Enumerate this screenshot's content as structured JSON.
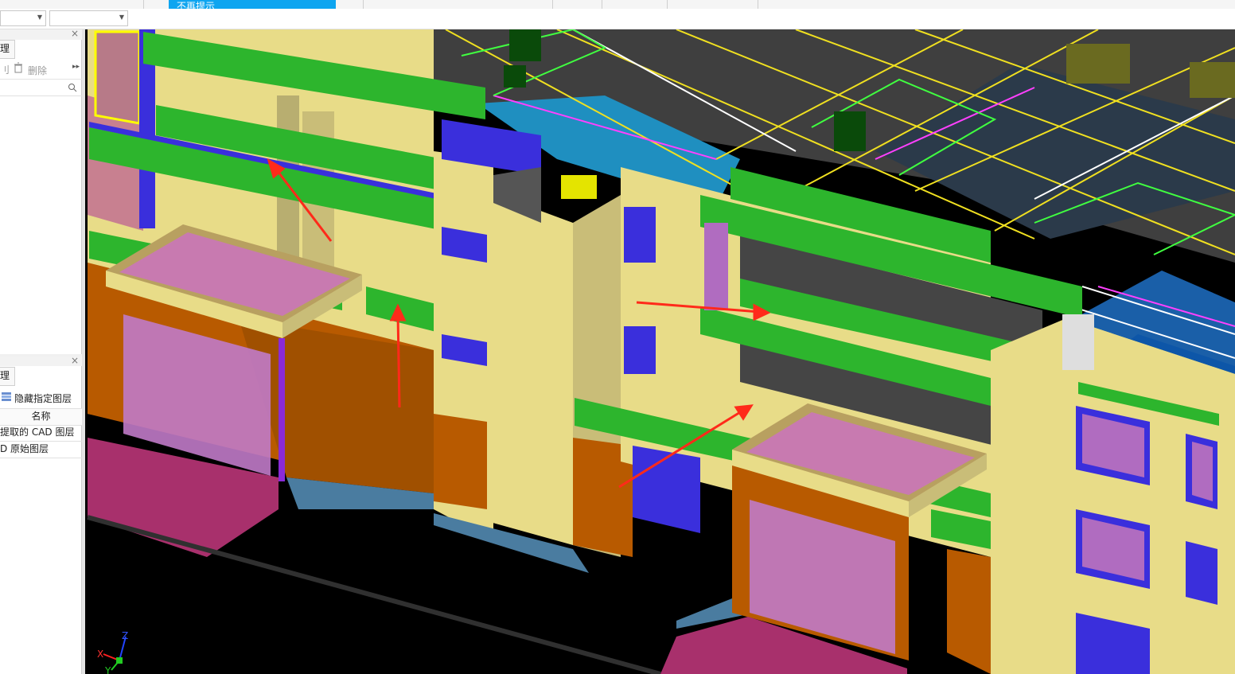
{
  "toolbar": {
    "tooltip": "不再提示"
  },
  "left_panel": {
    "top_tab": "理",
    "delete_label": "删除",
    "bottom_tab": "理",
    "hide_layer_label": "隐藏指定图层",
    "table_header": "名称",
    "rows": [
      "提取的 CAD 图层",
      "D 原始图层"
    ]
  },
  "viewport": {
    "axis_x": "X",
    "axis_y": "Y",
    "axis_z": "Z",
    "background": "#000000",
    "colors": {
      "wall": "#e8dc88",
      "beam": "#2db52d",
      "column": "#3a2fdc",
      "slab": "#454545",
      "door_frame": "#b85a00",
      "glass": "#b06cc0",
      "annotation_arrow": "#ff2a1a"
    }
  }
}
